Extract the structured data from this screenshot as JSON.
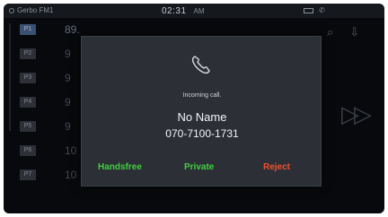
{
  "status_bar": {
    "source": "Gerbo FM1",
    "time": "02:31",
    "ampm": "AM"
  },
  "presets": [
    {
      "tag": "P1",
      "freq": "89.",
      "active": true
    },
    {
      "tag": "P2",
      "freq": "9",
      "active": false
    },
    {
      "tag": "P3",
      "freq": "9",
      "active": false
    },
    {
      "tag": "P4",
      "freq": "9",
      "active": false
    },
    {
      "tag": "P5",
      "freq": "9",
      "active": false
    },
    {
      "tag": "P6",
      "freq": "10",
      "active": false
    },
    {
      "tag": "P7",
      "freq": "10",
      "active": false
    }
  ],
  "dialog": {
    "icon": "phone-icon",
    "message": "Incoming call.",
    "caller_name": "No Name",
    "caller_number": "070-7100-1731",
    "buttons": {
      "handsfree": "Handsfree",
      "private": "Private",
      "reject": "Reject"
    }
  },
  "colors": {
    "accept": "#3fcf3f",
    "reject": "#f0502d",
    "dialog_bg": "#2c3036"
  }
}
